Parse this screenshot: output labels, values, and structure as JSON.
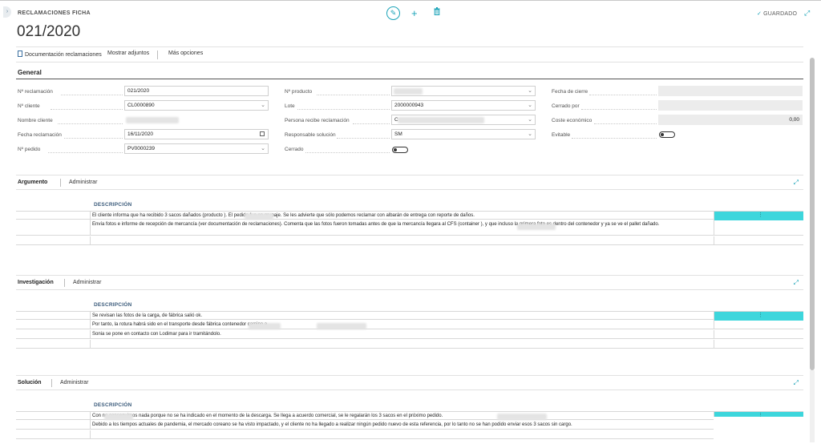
{
  "header": {
    "page_kind": "RECLAMACIONES FICHA",
    "title": "021/2020",
    "saved": "GUARDADO"
  },
  "actions": {
    "doc_reclamaciones": "Documentación reclamaciones",
    "mostrar_adjuntos": "Mostrar adjuntos",
    "mas_opciones": "Más opciones"
  },
  "general": {
    "title": "General",
    "col1": [
      {
        "label": "Nº reclamación",
        "value": "021/2020"
      },
      {
        "label": "Nº cliente",
        "value": "CL0000890"
      },
      {
        "label": "Nombre cliente",
        "value": ""
      },
      {
        "label": "Fecha reclamación",
        "value": "16/11/2020"
      },
      {
        "label": "Nº pedido",
        "value": "PV0000239"
      }
    ],
    "col2": [
      {
        "label": "Nº producto",
        "value": ""
      },
      {
        "label": "Lote",
        "value": "2000000943"
      },
      {
        "label": "Persona recibe reclamación",
        "value": "C"
      },
      {
        "label": "Responsable solución",
        "value": "SM"
      },
      {
        "label": "Cerrado",
        "value": ""
      }
    ],
    "col3": [
      {
        "label": "Fecha de cierre",
        "value": ""
      },
      {
        "label": "Cerrado por",
        "value": ""
      },
      {
        "label": "Coste económico",
        "value": "0,00"
      },
      {
        "label": "Evitable",
        "value": ""
      }
    ]
  },
  "parts": {
    "manage_label": "Administrar",
    "column_header": "DESCRIPCIÓN",
    "argumento": {
      "title": "Argumento",
      "rows": [
        "El cliente informa que ha recibido 3 sacos dañados (producto ). El pedido fue en grupaje. Se les advierte que sólo podemos reclamar con albarán de entrega con reporte de daños.",
        "Envía fotos e informe de recepción de mercancía (ver documentación de reclamaciones). Comenta que las fotos fueron tomadas antes de que la mercancía llegara al CFS (container ), y que incluso la primera foto es dentro del contenedor y ya se ve el pallet dañado."
      ]
    },
    "investigacion": {
      "title": "Investigación",
      "rows": [
        "Se revisan las fotos de la carga, de fábrica salió ok.",
        "Por tanto, la rotura habrá sido en el transporte desde fábrica contenedor camino a",
        "Sonia se pone en contacto con Lodimar para ir tramitándolo."
      ]
    },
    "solucion": {
      "title": "Solución",
      "rows": [
        "Con no conseguimos nada porque no se ha indicado en el momento de la descarga. Se llega a acuerdo comercial, se le regalarán los 3 sacos en el próximo pedido.",
        "Debido a los tiempos actuales de pandemia, el mercado coreano se ha visto impactado, y el cliente no ha llegado a realizar ningún pedido nuevo de esta referencia, por lo tanto no se han podido enviar esos 3 sacos sin cargo."
      ]
    }
  },
  "colors": {
    "accent": "#1aa3b8",
    "row_highlight": "#3dd6dc"
  }
}
